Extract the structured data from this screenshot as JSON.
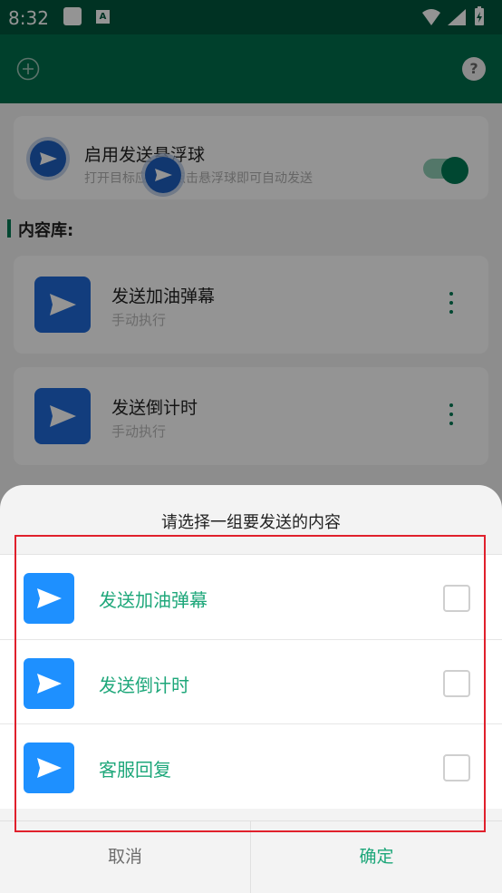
{
  "status_bar": {
    "time": "8:32",
    "a_icon_letter": "A"
  },
  "app_bar": {
    "add_icon": "plus-circle-icon",
    "help_icon_label": "?"
  },
  "float_card": {
    "title": "启用发送悬浮球",
    "subtitle": "打开目标应用后点击悬浮球即可自动发送",
    "toggle_on": true
  },
  "section": {
    "title": "内容库:"
  },
  "library_items": [
    {
      "title": "发送加油弹幕",
      "subtitle": "手动执行"
    },
    {
      "title": "发送倒计时",
      "subtitle": "手动执行"
    }
  ],
  "dialog": {
    "title": "请选择一组要发送的内容",
    "options": [
      {
        "label": "发送加油弹幕",
        "checked": false
      },
      {
        "label": "发送倒计时",
        "checked": false
      },
      {
        "label": "客服回复",
        "checked": false
      }
    ],
    "cancel_label": "取消",
    "confirm_label": "确定"
  },
  "colors": {
    "status_bar": "#00573d",
    "app_bar": "#006e4d",
    "accent_green": "#1ea77a",
    "icon_blue": "#1e90ff",
    "highlight_red": "#e0202c"
  }
}
